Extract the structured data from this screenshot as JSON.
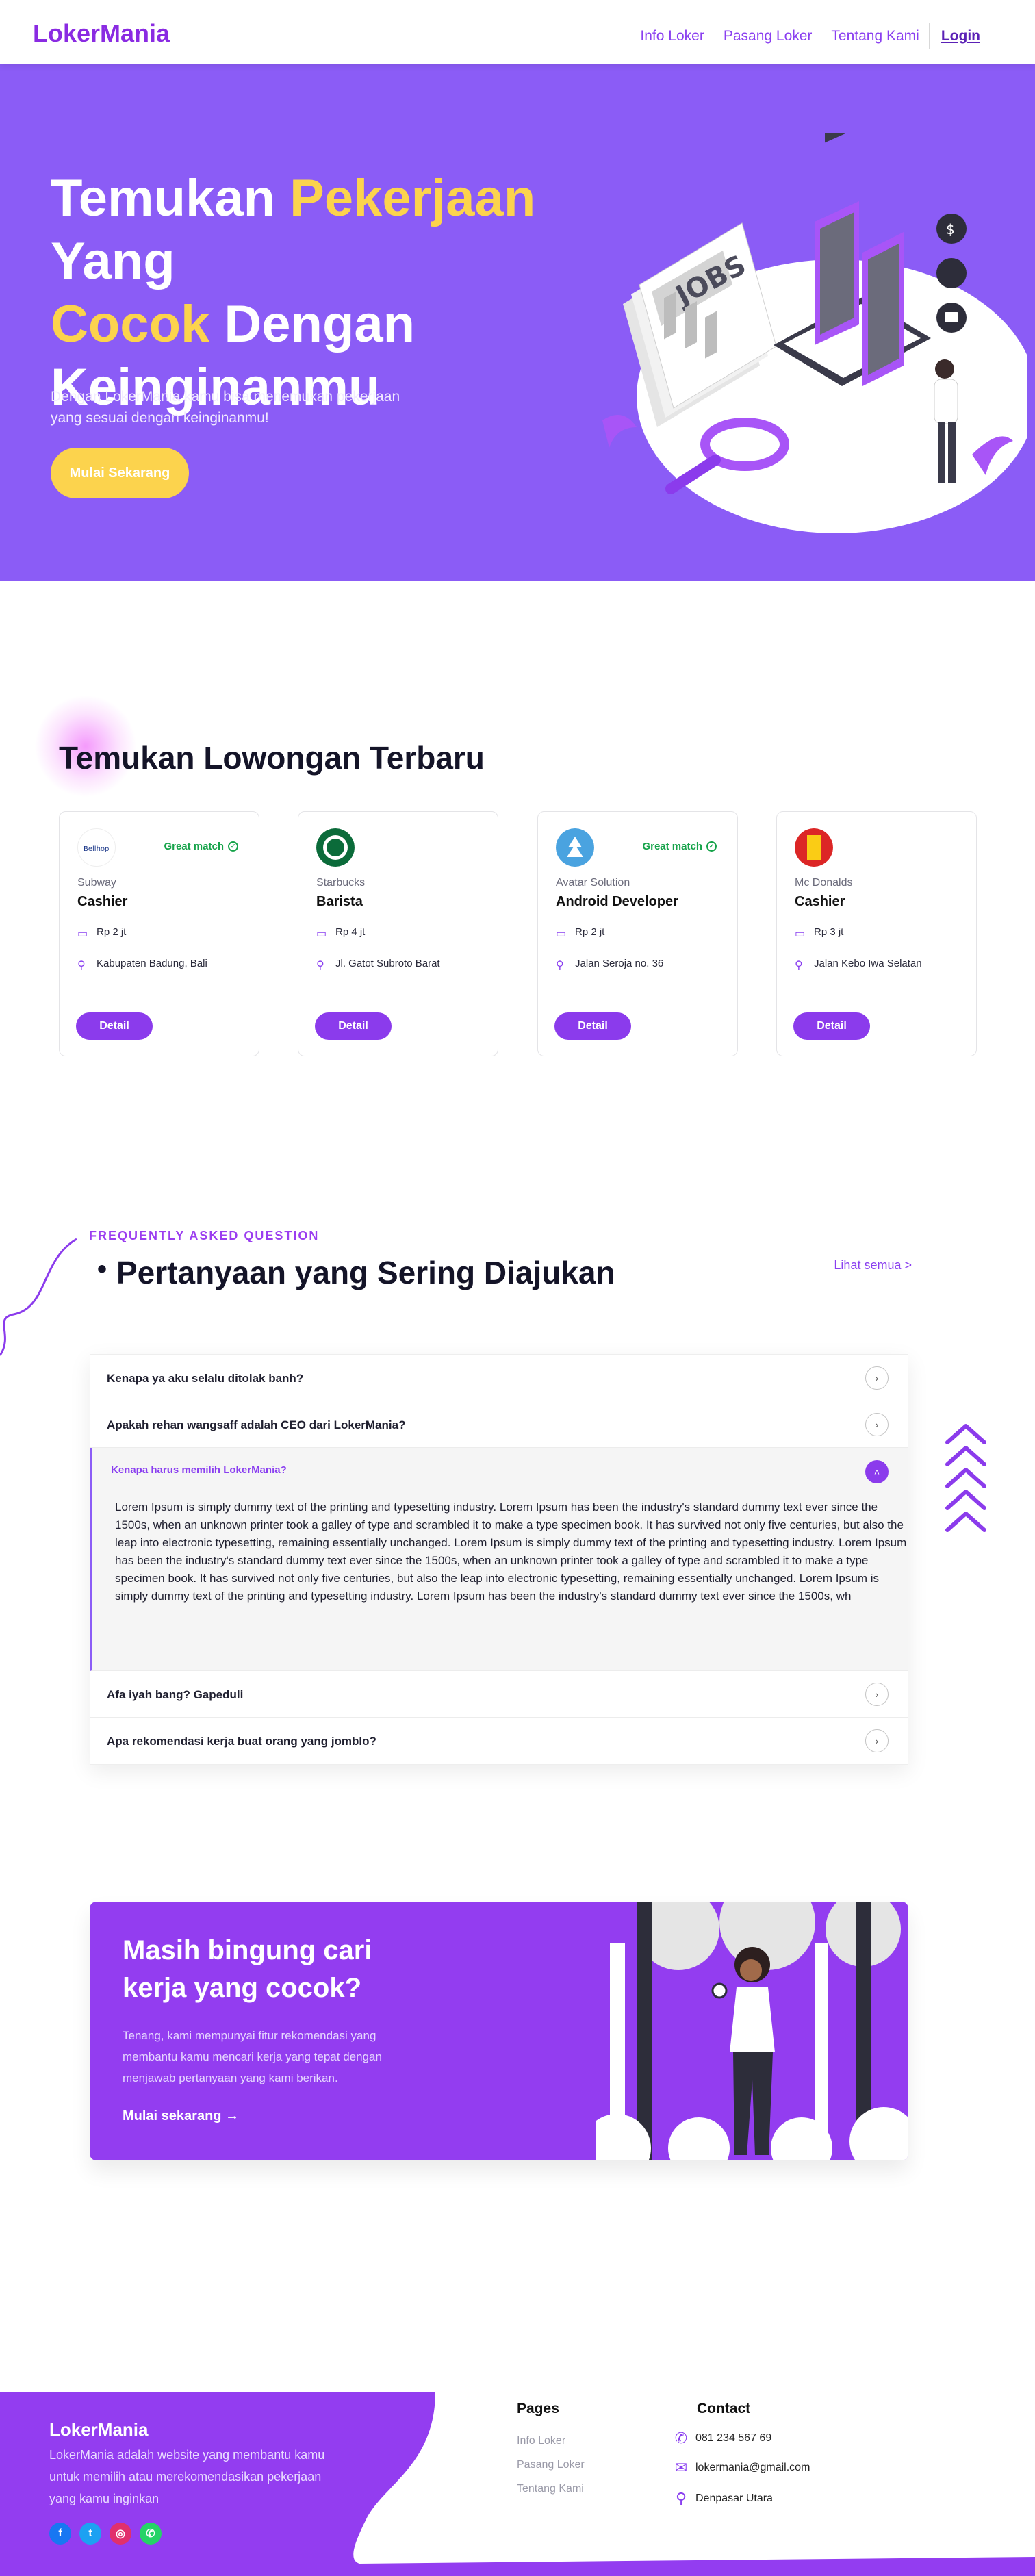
{
  "nav": {
    "logo": "LokerMania",
    "links": [
      "Info Loker",
      "Pasang Loker",
      "Tentang Kami"
    ],
    "login": "Login"
  },
  "hero": {
    "title_1": "Temukan ",
    "title_hl_1": "Pekerjaan",
    "title_2": " Yang ",
    "title_hl_2": "Cocok",
    "title_3": " Dengan Keinginanmu",
    "description": "Dengan LokerMania kamu bisa menemukan pekerjaan yang sesuai dengan keinginanmu!",
    "cta": "Mulai Sekarang",
    "illustration_text": "JOBS"
  },
  "jobs": {
    "title": "Temukan Lowongan Terbaru",
    "cards": [
      {
        "company": "Subway",
        "role": "Cashier",
        "salary": "Rp 2 jt",
        "location": "Kabupaten Badung, Bali",
        "match": "Great match",
        "button": "Detail",
        "logo_text": "Bellhop"
      },
      {
        "company": "Starbucks",
        "role": "Barista",
        "salary": "Rp 4 jt",
        "location": "Jl. Gatot Subroto Barat",
        "match": "",
        "button": "Detail",
        "logo_text": ""
      },
      {
        "company": "Avatar Solution",
        "role": "Android Developer",
        "salary": "Rp 2 jt",
        "location": "Jalan Seroja no. 36",
        "match": "Great match",
        "button": "Detail",
        "logo_text": ""
      },
      {
        "company": "Mc Donalds",
        "role": "Cashier",
        "salary": "Rp 3 jt",
        "location": "Jalan Kebo Iwa Selatan",
        "match": "",
        "button": "Detail",
        "logo_text": ""
      }
    ]
  },
  "faq": {
    "eyebrow": "FREQUENTLY ASKED QUESTION",
    "title": "Pertanyaan yang Sering Diajukan",
    "see_all": "Lihat semua  >",
    "items": [
      "Kenapa ya aku selalu ditolak banh?",
      "Apakah rehan wangsaff adalah CEO dari LokerMania?"
    ],
    "open_question": "Kenapa harus memilih LokerMania?",
    "open_answer": "Lorem Ipsum is simply dummy text of the printing and typesetting industry. Lorem Ipsum has been the industry's standard dummy text ever since the 1500s, when an unknown printer took a galley of type and scrambled it to make a type specimen book. It has survived not only five centuries, but also the leap into electronic typesetting, remaining essentially unchanged. Lorem Ipsum is simply dummy text of the printing and typesetting industry. Lorem Ipsum has been the industry's standard dummy text ever since the 1500s, when an unknown printer took a galley of type and scrambled it to make a type specimen book. It has survived not only five centuries, but also the leap into electronic typesetting, remaining essentially unchanged. Lorem Ipsum is simply dummy text of the printing and typesetting industry. Lorem Ipsum has been the industry's standard dummy text ever since the 1500s, wh",
    "items_after": [
      "Afa iyah bang? Gapeduli",
      "Apa rekomendasi kerja buat orang yang jomblo?"
    ]
  },
  "cta": {
    "title": "Masih bingung cari kerja yang cocok?",
    "description": "Tenang, kami mempunyai fitur rekomendasi yang membantu kamu mencari kerja yang tepat dengan menjawab pertanyaan yang kami berikan.",
    "link": "Mulai sekarang  →"
  },
  "footer": {
    "brand": "LokerMania",
    "description": "LokerMania adalah website yang membantu kamu untuk memilih atau merekomendasikan pekerjaan yang kamu inginkan",
    "pages_title": "Pages",
    "pages": [
      "Info Loker",
      "Pasang Loker",
      "Tentang Kami"
    ],
    "contact_title": "Contact",
    "phone": "081 234 567 69",
    "email": "lokermania@gmail.com",
    "address": "Denpasar Utara",
    "social_icons": [
      "facebook-icon",
      "twitter-icon",
      "instagram-icon",
      "whatsapp-icon"
    ]
  },
  "colors": {
    "brand": "#8a2be2",
    "hero_bg": "#8b5cf6",
    "accent_yellow": "#fcd34d",
    "button_purple": "#8b3bec"
  }
}
